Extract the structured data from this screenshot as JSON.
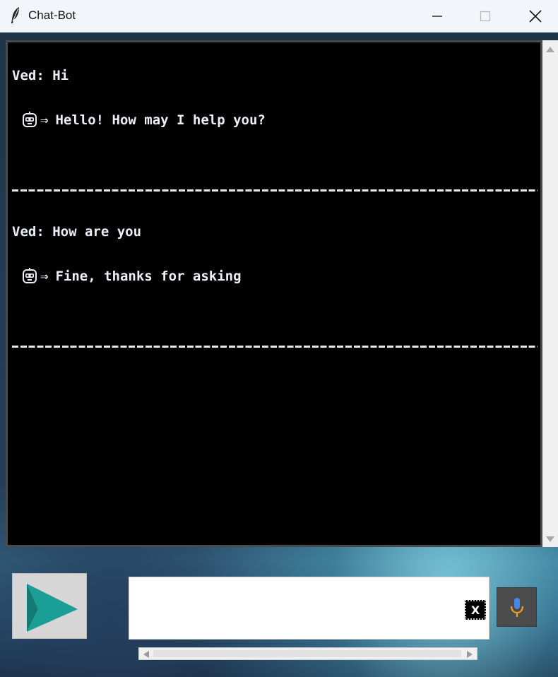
{
  "window": {
    "title": "Chat-Bot",
    "app_icon": "feather-icon",
    "controls": [
      "minimize-icon",
      "maximize-icon",
      "close-icon"
    ]
  },
  "chat": {
    "messages": [
      {
        "sender": "Ved",
        "text": "Ved: Hi"
      },
      {
        "sender": "bot",
        "icon": "robot-icon",
        "arrow": "⇒",
        "text": "Hello! How may I help you?"
      },
      {
        "sender": "Ved",
        "text": "Ved: How are you"
      },
      {
        "sender": "bot",
        "icon": "robot-icon",
        "arrow": "⇒",
        "text": "Fine, thanks for asking"
      }
    ],
    "separator": "-----------------------------------------------------------------------",
    "background": "#000000",
    "text_color": "#ecf0f4"
  },
  "input": {
    "value": "",
    "clear_label": "X"
  },
  "send_button": {
    "icon": "send-arrow-icon",
    "color": "#1a9e96"
  },
  "mic_button": {
    "icon": "microphone-icon",
    "colors": [
      "#4a86e8",
      "#f0a020"
    ]
  }
}
